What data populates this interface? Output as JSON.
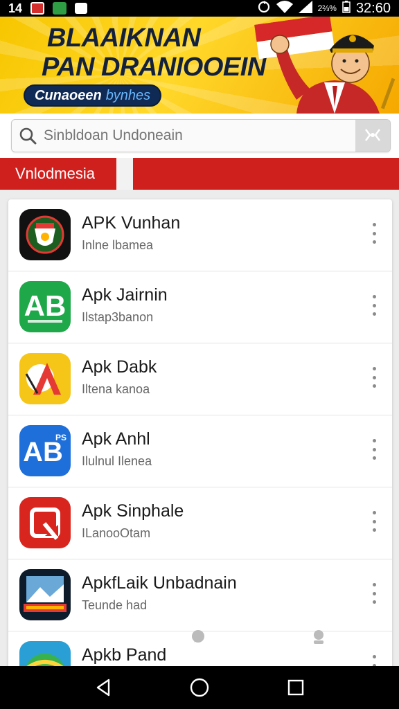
{
  "status_bar": {
    "left_time": "14",
    "battery_pct": "2⅔%",
    "clock": "32:60",
    "colors": {
      "badge_red": "#d32f2f",
      "badge_green": "#2e9d44"
    }
  },
  "banner": {
    "line1": "BLAAIKNAN",
    "line2": "PAN DRANIOOEIN",
    "pill_text": "Cunaoeen",
    "pill_accent": "bynhes",
    "colors": {
      "bg": "#f7c600",
      "text": "#13213d",
      "pill": "#0f2a55"
    }
  },
  "search": {
    "placeholder": "Sinbldoan Undoneain",
    "icon": "search-icon",
    "right_icon": "voice-icon"
  },
  "tabstrip": {
    "label": "Vnlodmesia",
    "color": "#d0201e"
  },
  "apps": [
    {
      "name": "APK Vunhan",
      "subtitle": "Inlne lbamea",
      "icon": "emblem-icon"
    },
    {
      "name": "Apk Jairnin",
      "subtitle": "Ilstap3banon",
      "icon": "ab-green-icon"
    },
    {
      "name": "Apk Dabk",
      "subtitle": "Iltena kanoa",
      "icon": "a-yellow-icon"
    },
    {
      "name": "Apk Anhl",
      "subtitle": "Ilulnul Ilenea",
      "icon": "ab-blue-icon"
    },
    {
      "name": "Apk Sinphale",
      "subtitle": "ILanooOtam",
      "icon": "dr-red-icon"
    },
    {
      "name": "ApkfLaik Unbadnain",
      "subtitle": "Teunde had",
      "icon": "poster-icon"
    },
    {
      "name": "Apkb Pand",
      "subtitle": "",
      "icon": "globe-icon"
    }
  ],
  "nav": {
    "back": "back-icon",
    "home": "home-icon",
    "recents": "recents-icon"
  }
}
